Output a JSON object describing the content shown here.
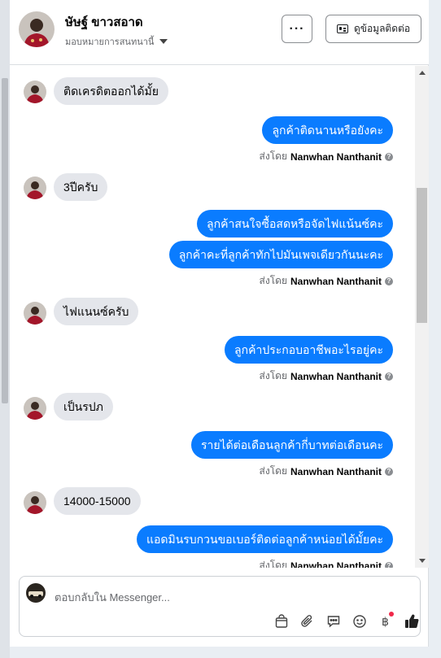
{
  "header": {
    "name": "ษัษฐ์ ขาวสอาด",
    "assign_label": "มอบหมายการสนทนานี้",
    "more_label": "···",
    "view_info_label": "ดูข้อมูลติดต่อ"
  },
  "messages": [
    {
      "type": "in",
      "text": "ติดเครดิตออกได้มั้ย"
    },
    {
      "type": "out",
      "text": "ลูกค้าติดนานหรือยังคะ"
    },
    {
      "type": "sent",
      "prefix": "ส่งโดย",
      "name": "Nanwhan Nanthanit"
    },
    {
      "type": "in",
      "text": "3ปีครับ"
    },
    {
      "type": "out",
      "text": "ลูกค้าสนใจซื้อสดหรือจัดไฟแน้นซ์คะ"
    },
    {
      "type": "out",
      "text": "ลูกค้าคะที่ลูกค้าทักไปมันเพจเดียวกันนะคะ"
    },
    {
      "type": "sent",
      "prefix": "ส่งโดย",
      "name": "Nanwhan Nanthanit"
    },
    {
      "type": "in",
      "text": "ไฟแนนซ์ครับ"
    },
    {
      "type": "out",
      "text": "ลูกค้าประกอบอาชีพอะไรอยู่คะ"
    },
    {
      "type": "sent",
      "prefix": "ส่งโดย",
      "name": "Nanwhan Nanthanit"
    },
    {
      "type": "in",
      "text": "เป็นรปภ"
    },
    {
      "type": "out",
      "text": "รายได้ต่อเดือนลูกค้ากี่บาทต่อเดือนคะ"
    },
    {
      "type": "sent",
      "prefix": "ส่งโดย",
      "name": "Nanwhan Nanthanit"
    },
    {
      "type": "in",
      "text": "14000-15000"
    },
    {
      "type": "out",
      "text": "แอดมินรบกวนขอเบอร์ติดต่อลูกค้าหน่อยได้มั้ยคะ"
    },
    {
      "type": "sent",
      "prefix": "ส่งโดย",
      "name": "Nanwhan Nanthanit"
    }
  ],
  "composer": {
    "placeholder": "ตอบกลับใน Messenger..."
  },
  "tools": [
    "shopping-bag-icon",
    "paperclip-icon",
    "saved-reply-icon",
    "emoji-icon",
    "baht-payment-icon",
    "like-icon"
  ],
  "colors": {
    "outgoing_bubble": "#0a7cff",
    "incoming_bubble": "#e4e6eb",
    "notification_dot": "#f02849"
  }
}
